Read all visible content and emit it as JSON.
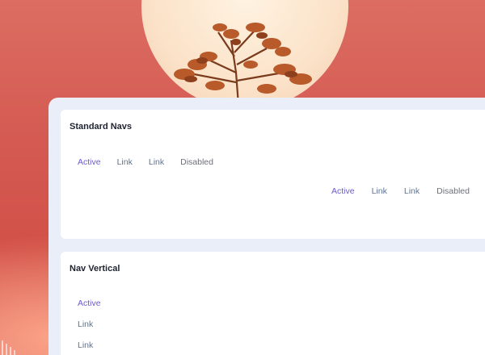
{
  "colors": {
    "active": "#6a5cd0",
    "link": "#5f7390",
    "disabled": "#6c6f78",
    "background": "#d85a4f",
    "panel": "#e9eef8"
  },
  "standard_navs": {
    "title": "Standard Navs",
    "left_nav": [
      "Active",
      "Link",
      "Link",
      "Disabled"
    ],
    "right_nav": [
      "Active",
      "Link",
      "Link",
      "Disabled"
    ]
  },
  "nav_vertical": {
    "title": "Nav Vertical",
    "items": [
      "Active",
      "Link",
      "Link"
    ]
  }
}
